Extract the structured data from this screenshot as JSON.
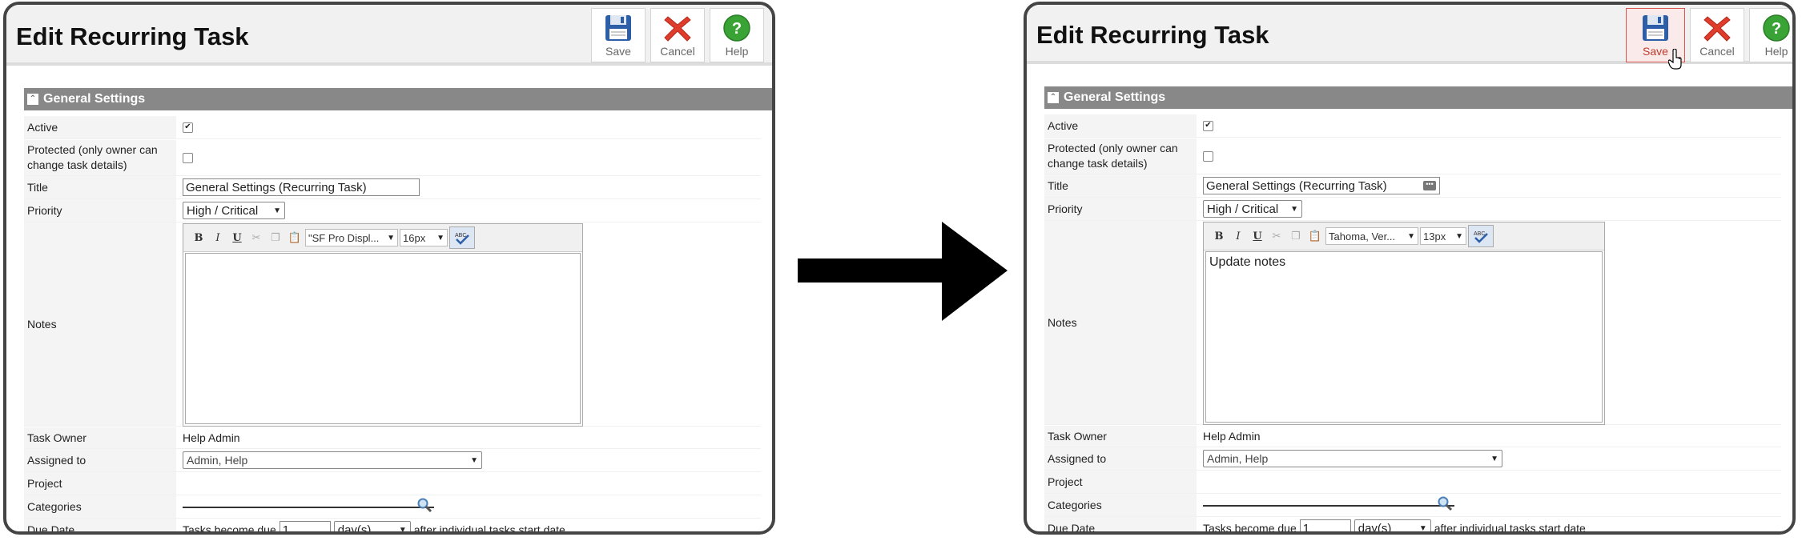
{
  "before": {
    "title": "Edit Recurring Task",
    "toolbar": {
      "save": "Save",
      "cancel": "Cancel",
      "help": "Help"
    },
    "section": "General Settings",
    "labels": {
      "active": "Active",
      "protected_1": "Protected (only owner can",
      "protected_2": "change task details)",
      "title": "Title",
      "priority": "Priority",
      "notes": "Notes",
      "task_owner": "Task Owner",
      "assigned_to": "Assigned to",
      "project": "Project",
      "categories": "Categories",
      "due_date": "Due Date"
    },
    "values": {
      "title": "General Settings (Recurring Task)",
      "priority": "High / Critical",
      "font": "\"SF Pro Displ...",
      "size": "16px",
      "notes": "",
      "task_owner": "Help Admin",
      "assigned_to": "Admin, Help",
      "due_prefix": "Tasks become due",
      "due_value": "1",
      "due_unit": "day(s)",
      "due_suffix": "after individual tasks start date"
    }
  },
  "after": {
    "title": "Edit Recurring Task",
    "toolbar": {
      "save": "Save",
      "cancel": "Cancel",
      "help": "Help"
    },
    "section": "General Settings",
    "labels": {
      "active": "Active",
      "protected_1": "Protected (only owner can",
      "protected_2": "change task details)",
      "title": "Title",
      "priority": "Priority",
      "notes": "Notes",
      "task_owner": "Task Owner",
      "assigned_to": "Assigned to",
      "project": "Project",
      "categories": "Categories",
      "due_date": "Due Date"
    },
    "values": {
      "title": "General Settings (Recurring Task)",
      "priority": "High / Critical",
      "font": "Tahoma, Ver...",
      "size": "13px",
      "notes": "Update notes",
      "task_owner": "Help Admin",
      "assigned_to": "Admin, Help",
      "due_prefix": "Tasks become due",
      "due_value": "1",
      "due_unit": "day(s)",
      "due_suffix": "after individual tasks start date"
    }
  },
  "icons": {
    "save": "floppy-disk-icon",
    "cancel": "red-x-icon",
    "help": "green-question-icon"
  },
  "colors": {
    "section": "#888888",
    "save_active_border": "#d9534f",
    "help_green": "#3aa335",
    "cancel_red": "#e03c2c"
  }
}
